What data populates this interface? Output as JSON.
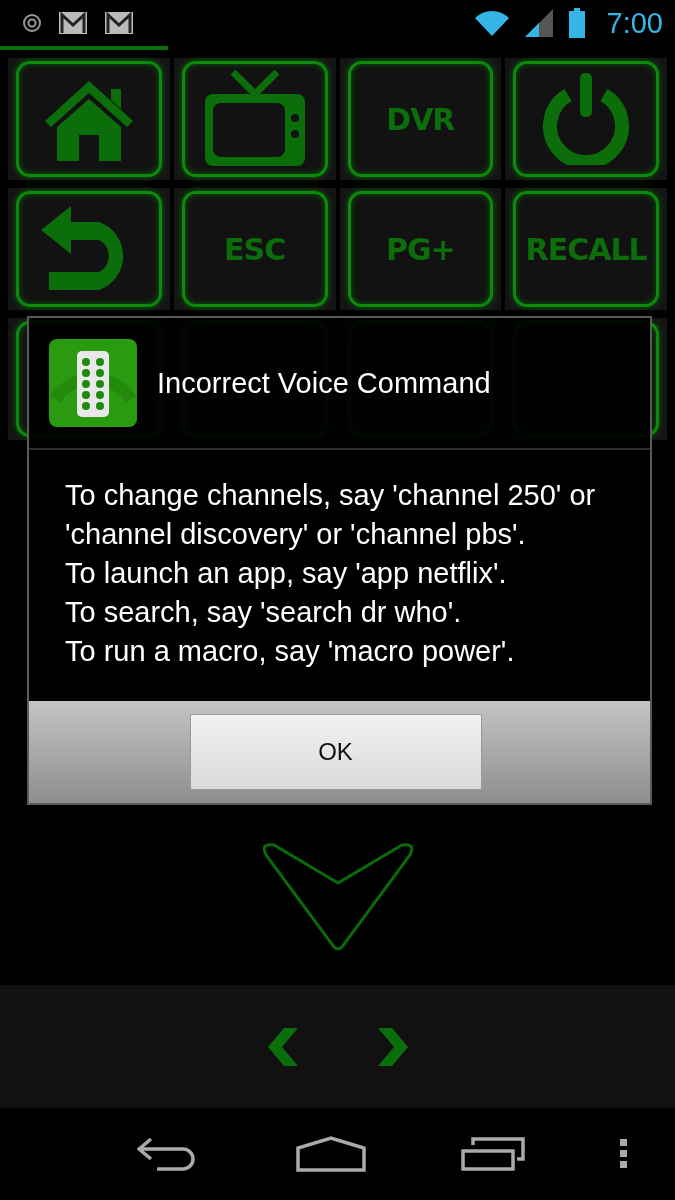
{
  "status_bar": {
    "time": "7:00"
  },
  "remote_buttons": [
    {
      "kind": "home"
    },
    {
      "kind": "tv"
    },
    {
      "kind": "text",
      "label": "DVR"
    },
    {
      "kind": "power"
    },
    {
      "kind": "back"
    },
    {
      "kind": "text",
      "label": "ESC"
    },
    {
      "kind": "text",
      "label": "PG+"
    },
    {
      "kind": "text",
      "label": "RECALL"
    }
  ],
  "dialog": {
    "title": "Incorrect Voice Command",
    "message": [
      "To change channels, say 'channel 250' or 'channel discovery' or 'channel pbs'.",
      "To launch an app, say 'app netflix'.",
      "To search, say 'search dr who'.",
      "To run a macro, say 'macro power'."
    ],
    "button": "OK"
  }
}
